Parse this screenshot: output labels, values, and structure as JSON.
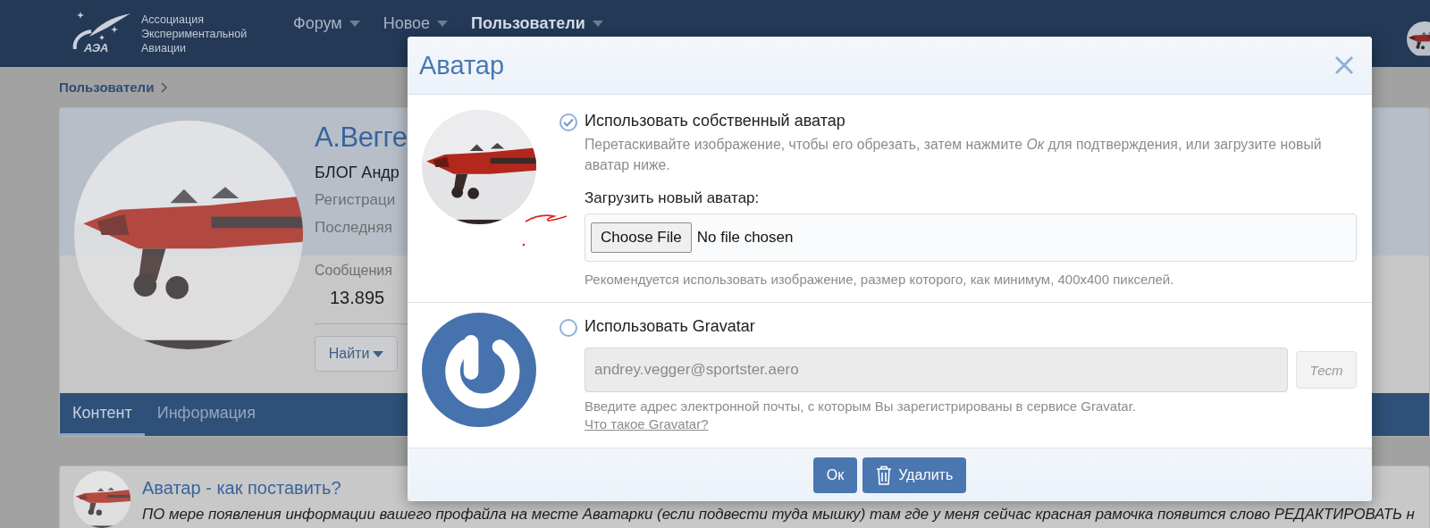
{
  "header": {
    "logo_mark": "АЭА",
    "logo_text": [
      "Ассоциация",
      "Экспериментальной",
      "Авиации"
    ],
    "nav": [
      {
        "label": "Форум",
        "selected": false
      },
      {
        "label": "Новое",
        "selected": false
      },
      {
        "label": "Пользователи",
        "selected": true
      }
    ]
  },
  "breadcrumb": [
    {
      "label": "Пользователи"
    }
  ],
  "profile": {
    "name": "А.Вегге",
    "title": "БЛОГ Андр",
    "lines": [
      "Регистраци",
      "Последняя"
    ],
    "stats": [
      {
        "label": "Сообщения",
        "value": "13.895"
      }
    ],
    "find_button": "Найти",
    "tabs": [
      {
        "label": "Контент",
        "selected": true
      },
      {
        "label": "Информация",
        "selected": false
      }
    ]
  },
  "post": {
    "title": "Аватар - как поставить?",
    "text": "ПО мере появления информации вашего профайла на месте Аватарки (если подвести туда мышку) там где у меня сейчас красная рамочка появится слово РЕДАКТИРОВАТЬ н"
  },
  "dialog": {
    "title": "Аватар",
    "options": [
      {
        "kind": "custom",
        "label": "Использовать собственный аватар",
        "selected": true,
        "description": "Перетаскивайте изображение, чтобы его обрезать, затем нажмите *Ок* для подтверждения, или загрузите новый аватар ниже.",
        "upload_label": "Загрузить новый аватар:",
        "file_button": "Choose File",
        "file_status": "No file chosen",
        "hint": "Рекомендуется использовать изображение, размер которого, как минимум, 400x400 пикселей."
      },
      {
        "kind": "gravatar",
        "label": "Использовать Gravatar",
        "selected": false,
        "email": "andrey.vegger@sportster.aero",
        "disabled": true,
        "test_button": "Тест",
        "hint": "Введите адрес электронной почты, с которым Вы зарегистрированы в сервисе Gravatar.",
        "link": "Что такое Gravatar?"
      }
    ],
    "buttons": [
      {
        "kind": "confirm",
        "label": "Ок"
      },
      {
        "kind": "delete",
        "label": "Удалить"
      }
    ]
  }
}
